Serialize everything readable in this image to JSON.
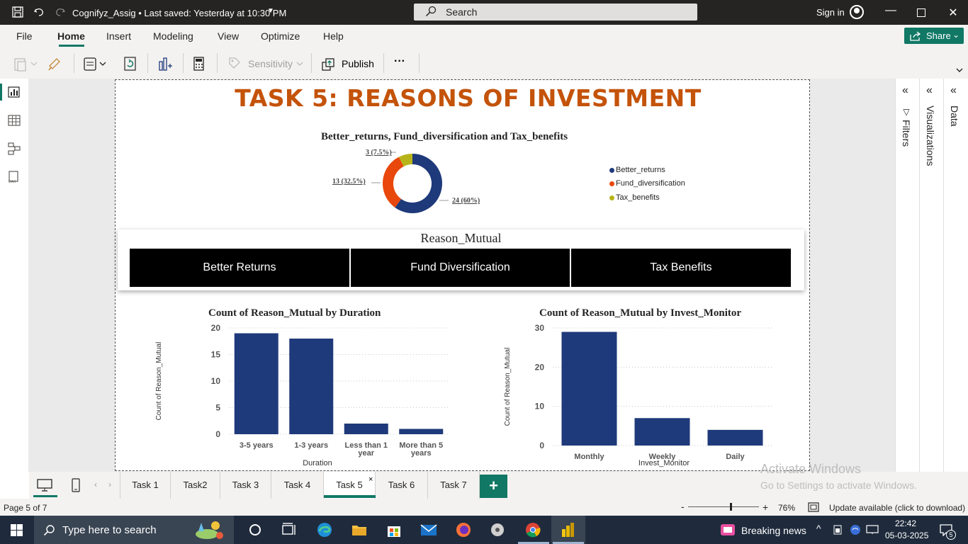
{
  "window": {
    "title": "Cognifyz_Assig • Last saved: Yesterday at 10:30 PM",
    "search_label": "Search",
    "signin_label": "Sign in"
  },
  "menu": {
    "items": [
      "File",
      "Home",
      "Insert",
      "Modeling",
      "View",
      "Optimize",
      "Help"
    ],
    "share_label": "Share"
  },
  "ribbon": {
    "sensitivity_label": "Sensitivity",
    "publish_label": "Publish",
    "more_label": "···"
  },
  "panes": {
    "filters_label": "Filters",
    "visualizations_label": "Visualizations",
    "data_label": "Data"
  },
  "report": {
    "title": "TASK 5: REASONS OF INVESTMENT",
    "donut_title": "Better_returns, Fund_diversification and Tax_benefits",
    "slicer_title": "Reason_Mutual",
    "slicer_options": [
      "Better Returns",
      "Fund Diversification",
      "Tax Benefits"
    ]
  },
  "chart_data": [
    {
      "type": "pie",
      "title": "Better_returns, Fund_diversification and Tax_benefits",
      "categories": [
        "Better_returns",
        "Fund_diversification",
        "Tax_benefits"
      ],
      "values": [
        24,
        13,
        3
      ],
      "data_labels": [
        "24 (60%)",
        "13 (32.5%)",
        "3 (7.5%)"
      ],
      "colors": [
        "#1f3a7a",
        "#e8480c",
        "#b7b41a"
      ],
      "legend_position": "right"
    },
    {
      "type": "bar",
      "title": "Count of Reason_Mutual by Duration",
      "categories": [
        "3-5 years",
        "1-3 years",
        "Less than 1 year",
        "More than 5 years"
      ],
      "values": [
        19,
        18,
        2,
        1
      ],
      "xlabel": "Duration",
      "ylabel": "Count of Reason_Mutual",
      "yticks": [
        "0",
        "5",
        "10",
        "15",
        "20"
      ],
      "ylim": [
        0,
        20
      ],
      "color": "#1f3a7a",
      "grid": true
    },
    {
      "type": "bar",
      "title": "Count of Reason_Mutual by Invest_Monitor",
      "categories": [
        "Monthly",
        "Weekly",
        "Daily"
      ],
      "values": [
        29,
        7,
        4
      ],
      "xlabel": "Invest_Monitor",
      "ylabel": "Count of Reason_Mutual",
      "yticks": [
        "0",
        "10",
        "20",
        "30"
      ],
      "ylim": [
        0,
        30
      ],
      "color": "#1f3a7a",
      "grid": true
    }
  ],
  "tabs": {
    "items": [
      "Task 1",
      "Task2",
      "Task 3",
      "Task 4",
      "Task 5",
      "Task 6",
      "Task 7"
    ],
    "active": "Task 5",
    "close_label": "×",
    "add_label": "+"
  },
  "watermark": {
    "line1": "Activate Windows",
    "line2": "Go to Settings to activate Windows."
  },
  "status": {
    "page_label": "Page 5 of 7",
    "zoom_minus": "-",
    "zoom_plus": "+",
    "zoom_level": "76%",
    "zoom_fraction": 0.6,
    "update_label": "Update available (click to download)"
  },
  "taskbar": {
    "search_placeholder": "Type here to search",
    "news_label": "Breaking news",
    "time": "22:42",
    "date": "05-03-2025",
    "notification_count": "5"
  }
}
